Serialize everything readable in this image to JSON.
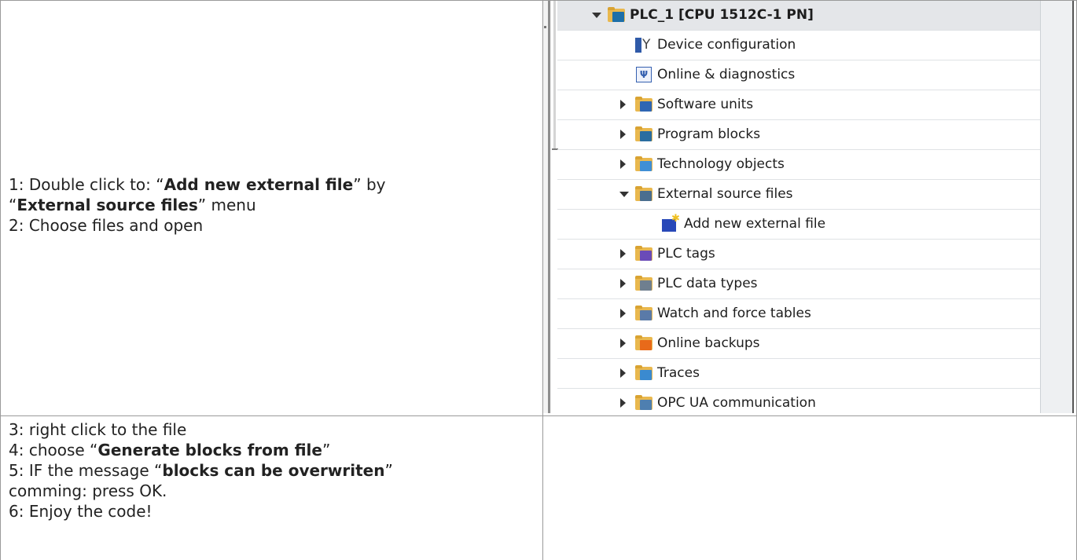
{
  "left_cell_top": {
    "lines": [
      {
        "prefix": "1: Double click to: “",
        "bold": "Add new external file",
        "suffix": "” by"
      },
      {
        "prefix": "“",
        "bold": "External source files",
        "suffix": "” menu"
      },
      {
        "prefix": "2: Choose files and open",
        "bold": "",
        "suffix": ""
      }
    ]
  },
  "left_cell_bottom": {
    "lines": [
      {
        "prefix": "3: right click to the file",
        "bold": "",
        "suffix": ""
      },
      {
        "prefix": "4: choose “",
        "bold": "Generate blocks from file",
        "suffix": "”"
      },
      {
        "prefix": "5: IF the message “",
        "bold": "blocks can be overwriten",
        "suffix": "”"
      },
      {
        "prefix": "comming: press OK.",
        "bold": "",
        "suffix": ""
      },
      {
        "prefix": "6: Enjoy the code!",
        "bold": "",
        "suffix": ""
      }
    ]
  },
  "project_tree": {
    "items": [
      {
        "label": "PLC_1 [CPU 1512C-1 PN]",
        "icon": "plc-cpu-icon",
        "expander": "down",
        "bold": true,
        "selected": true,
        "color": "#1d6fa8"
      },
      {
        "label": "Device configuration",
        "icon": "device-configuration-icon",
        "expander": "none",
        "color": "#2f5aa8"
      },
      {
        "label": "Online & diagnostics",
        "icon": "online-diagnostics-icon",
        "expander": "none",
        "color": "#3560b0"
      },
      {
        "label": "Software units",
        "icon": "software-units-folder-icon",
        "expander": "right",
        "color": "#2f66b3"
      },
      {
        "label": "Program blocks",
        "icon": "program-blocks-folder-icon",
        "expander": "right",
        "color": "#2a6da0"
      },
      {
        "label": "Technology objects",
        "icon": "technology-objects-folder-icon",
        "expander": "right",
        "color": "#3f8fd6"
      },
      {
        "label": "External source files",
        "icon": "external-source-files-folder-icon",
        "expander": "down",
        "color": "#4a6e8f"
      },
      {
        "label": "Add new external file",
        "icon": "add-new-external-file-icon",
        "expander": "none",
        "color": "#2848b8"
      },
      {
        "label": "PLC tags",
        "icon": "plc-tags-folder-icon",
        "expander": "right",
        "color": "#6a4bb8"
      },
      {
        "label": "PLC data types",
        "icon": "plc-data-types-folder-icon",
        "expander": "right",
        "color": "#6f7f8f"
      },
      {
        "label": "Watch and force tables",
        "icon": "watch-force-tables-folder-icon",
        "expander": "right",
        "color": "#5a7aa8"
      },
      {
        "label": "Online backups",
        "icon": "online-backups-folder-icon",
        "expander": "right",
        "color": "#e86a1a"
      },
      {
        "label": "Traces",
        "icon": "traces-folder-icon",
        "expander": "right",
        "color": "#3a8ad0"
      },
      {
        "label": "OPC UA communication",
        "icon": "opc-ua-communication-folder-icon",
        "expander": "right",
        "color": "#4e7fb0"
      }
    ]
  }
}
